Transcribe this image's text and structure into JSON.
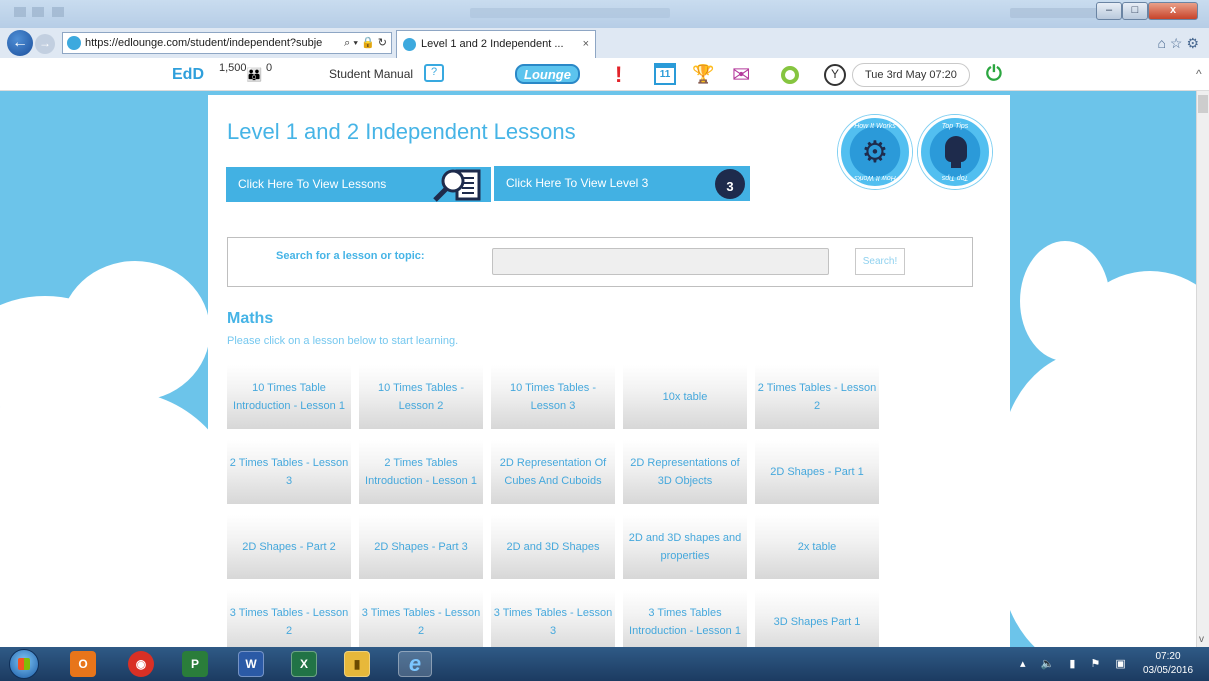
{
  "browser": {
    "url": "https://edlounge.com/student/independent?subje",
    "tab_title": "Level 1 and 2 Independent ...",
    "tab_close": "×",
    "address_tools": "⌕ ▾ 🔒 ↻",
    "back": "←",
    "forward": "→",
    "window_minimize": "–",
    "window_maximize": "□",
    "window_close": "x",
    "right_icons": "⌂☆⚙"
  },
  "header": {
    "logo": "EdD",
    "points": "1,500",
    "people_count": "0",
    "manual_label": "Student Manual",
    "tv_glyph": "?",
    "lounge_logo": "Lounge",
    "alert_glyph": "!",
    "calendar_day": "11",
    "trophy_glyph": "🏆",
    "mail_glyph": "✉",
    "clock_glyph": "Y",
    "datetime": "Tue 3rd May 07:20",
    "power_glyph": "⏻",
    "people_glyph": "👪"
  },
  "page": {
    "title": "Level 1 and 2 Independent Lessons",
    "view_lessons_label": "Click Here To View Lessons",
    "view_level3_label": "Click Here To View Level 3",
    "level3_badge": "3",
    "how_it_works": "How It Works",
    "top_tips": "Top Tips",
    "gear_glyph": "⚙",
    "search_label": "Search for a lesson or topic:",
    "search_placeholder": "",
    "search_button": "Search!",
    "subject": "Maths",
    "subject_instruction": "Please click on a lesson below to start learning."
  },
  "lessons": [
    [
      "10 Times Table Introduction - Lesson 1",
      "10 Times Tables - Lesson 2",
      "10 Times Tables - Lesson 3",
      "10x table",
      "2 Times Tables - Lesson 2"
    ],
    [
      "2 Times Tables - Lesson 3",
      "2 Times Tables Introduction - Lesson 1",
      "2D Representation Of Cubes And Cuboids",
      "2D Representations of 3D Objects",
      "2D Shapes - Part 1"
    ],
    [
      "2D Shapes - Part 2",
      "2D Shapes - Part 3",
      "2D and 3D Shapes",
      "2D and 3D shapes and properties",
      "2x table"
    ],
    [
      "3 Times Tables - Lesson 2",
      "3 Times Tables - Lesson 2",
      "3 Times Tables - Lesson 3",
      "3 Times Tables Introduction - Lesson 1",
      "3D Shapes Part 1"
    ]
  ],
  "taskbar": {
    "apps": [
      "O",
      "◉",
      "P",
      "W",
      "X",
      "▮",
      "e"
    ],
    "time": "07:20",
    "date": "03/05/2016",
    "tray": "▴ 🔈 ▮ ⚑ ▣"
  },
  "colors": {
    "accent": "#42b1e3",
    "sky": "#6cc4ea",
    "text_blue": "#46b4e6"
  }
}
